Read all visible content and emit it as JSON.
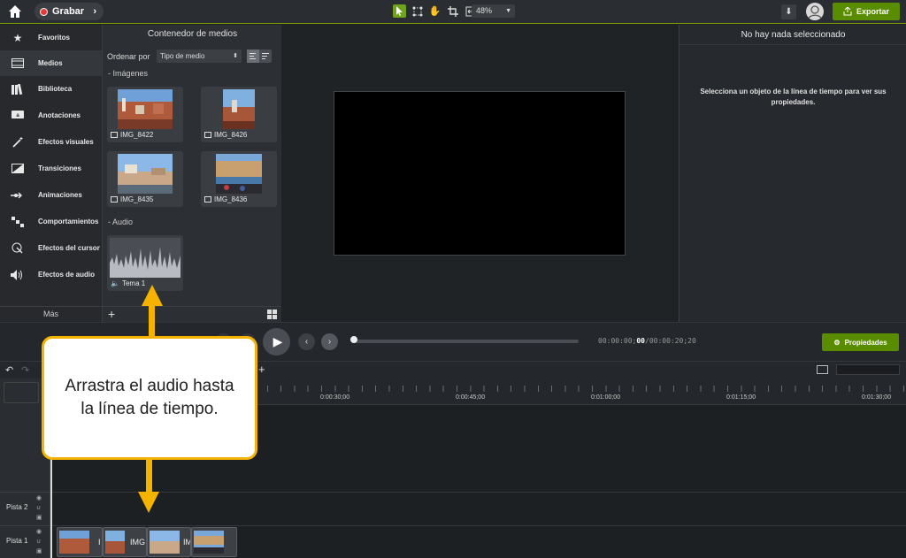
{
  "topbar": {
    "record_label": "Grabar",
    "zoom_value": "48%",
    "export_label": "Exportar",
    "icons": [
      "home-icon",
      "record-dot-icon",
      "chevron-right-icon",
      "pointer-icon",
      "selection-icon",
      "pan-hand-icon",
      "crop-icon",
      "resize-icon",
      "download-icon",
      "avatar-icon",
      "export-icon"
    ]
  },
  "sidebar": {
    "items": [
      {
        "label": "Favoritos",
        "icon": "star-icon",
        "active": false
      },
      {
        "label": "Medios",
        "icon": "film-icon",
        "active": true
      },
      {
        "label": "Biblioteca",
        "icon": "library-icon",
        "active": false
      },
      {
        "label": "Anotaciones",
        "icon": "annotation-icon",
        "active": false
      },
      {
        "label": "Efectos visuales",
        "icon": "magic-wand-icon",
        "active": false
      },
      {
        "label": "Transiciones",
        "icon": "transition-icon",
        "active": false
      },
      {
        "label": "Animaciones",
        "icon": "animation-arrow-icon",
        "active": false
      },
      {
        "label": "Comportamientos",
        "icon": "behavior-icon",
        "active": false
      },
      {
        "label": "Efectos del cursor",
        "icon": "cursor-effect-icon",
        "active": false
      },
      {
        "label": "Efectos de audio",
        "icon": "speaker-icon",
        "active": false
      }
    ],
    "more_label": "Más"
  },
  "media": {
    "title": "Contenedor de medios",
    "sort_label": "Ordenar por",
    "sort_value": "Tipo de medio",
    "images_section": "Imágenes",
    "audio_section": "Audio",
    "images": [
      {
        "name": "IMG_8422"
      },
      {
        "name": "IMG_8426"
      },
      {
        "name": "IMG_8435"
      },
      {
        "name": "IMG_8436"
      }
    ],
    "audio": [
      {
        "name": "Tema 1"
      }
    ]
  },
  "properties": {
    "title": "No hay nada seleccionado",
    "message": "Selecciona un objeto de la línea de tiempo para ver sus propiedades.",
    "button_label": "Propiedades"
  },
  "transport": {
    "timecode_current": "00:00:00;",
    "timecode_current_frames": "00",
    "timecode_total": "/00:00:20;20"
  },
  "timeline": {
    "ruler_labels": [
      "0:00:30;00",
      "0:00:45;00",
      "0:01:00;00",
      "0:01:15;00",
      "0:01:30;00"
    ],
    "tracks": [
      {
        "name": "Pista 2"
      },
      {
        "name": "Pista 1"
      }
    ],
    "clips": [
      {
        "label": "I"
      },
      {
        "label": "IMG"
      },
      {
        "label": "IM"
      },
      {
        "label": ""
      }
    ]
  },
  "callout": {
    "text": "Arrastra el audio hasta la línea de tiempo."
  },
  "colors": {
    "accent_green": "#5a8c00",
    "callout_border": "#f5b300",
    "record_red": "#e53935"
  }
}
